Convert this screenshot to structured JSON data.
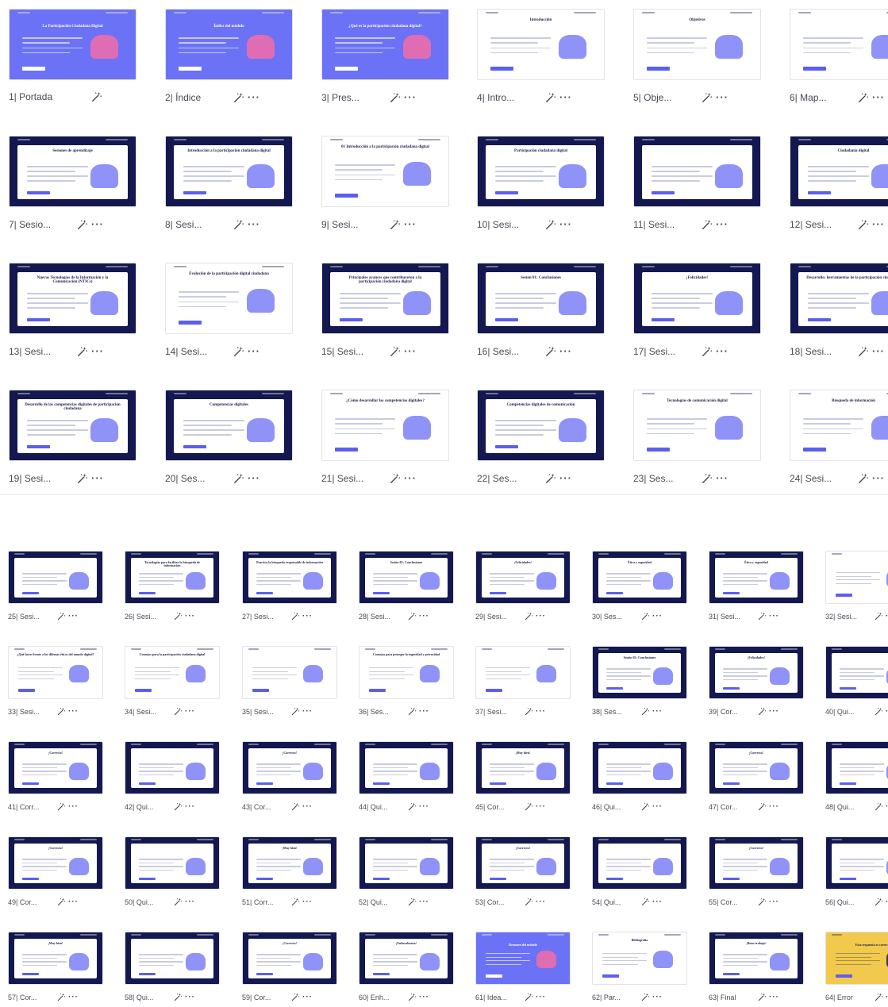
{
  "colors": {
    "purple": "#6c72f5",
    "navy": "#141850",
    "white": "#ffffff",
    "yellow": "#f1c94c",
    "text_dark": "#1d1d4a",
    "caption": "#4a4a55"
  },
  "icons": {
    "wand": "magic-wand-icon",
    "more": "more-options-icon"
  },
  "section1": {
    "slides": [
      {
        "label": "1| Portada",
        "bg": "purple",
        "title": "La Participación Ciudadana Digital",
        "more": false
      },
      {
        "label": "2| Índice",
        "bg": "purple",
        "title": "Índice del módulo",
        "more": true
      },
      {
        "label": "3| Pres...",
        "bg": "purple",
        "title": "¿Qué es la participación ciudadana digital?",
        "more": true
      },
      {
        "label": "4| Intro...",
        "bg": "white",
        "title": "Introducción",
        "more": true
      },
      {
        "label": "5| Obje...",
        "bg": "white",
        "title": "Objetivos",
        "more": true
      },
      {
        "label": "6| Map...",
        "bg": "white",
        "title": "",
        "more": true
      },
      {
        "label": "7| Sesio...",
        "bg": "navy",
        "title": "Sesiones de aprendizaje",
        "more": true
      },
      {
        "label": "8| Sesi...",
        "bg": "navy",
        "title": "Introducción a la participación ciudadana digital",
        "more": true
      },
      {
        "label": "9| Sesi...",
        "bg": "white",
        "title": "01 Introducción a la participación ciudadana digital",
        "more": true
      },
      {
        "label": "10| Sesi...",
        "bg": "navy",
        "title": "Participación ciudadana digital",
        "more": true
      },
      {
        "label": "11| Sesi...",
        "bg": "navy",
        "title": "",
        "more": true
      },
      {
        "label": "12| Sesi...",
        "bg": "navy",
        "title": "Ciudadanía digital",
        "more": true
      },
      {
        "label": "13| Sesi...",
        "bg": "navy",
        "title": "Nuevas Tecnologías de la Información y la Comunicación (NTICs)",
        "more": true
      },
      {
        "label": "14| Sesi...",
        "bg": "white",
        "title": "Evolución de la participación digital ciudadana",
        "more": true
      },
      {
        "label": "15| Sesi...",
        "bg": "navy",
        "title": "Principales avances que contribuyeron a la participación ciudadana digital",
        "more": true
      },
      {
        "label": "16| Sesi...",
        "bg": "navy",
        "title": "Sesión 01: Conclusiones",
        "more": true
      },
      {
        "label": "17| Sesi...",
        "bg": "navy",
        "title": "¡Felicidades!",
        "more": true
      },
      {
        "label": "18| Sesi...",
        "bg": "navy",
        "title": "Desarrollo: herramientas de la participación ciudadana",
        "more": true
      },
      {
        "label": "19| Sesi...",
        "bg": "navy",
        "title": "Desarrollo de las competencias digitales de participación ciudadana",
        "more": true
      },
      {
        "label": "20| Ses...",
        "bg": "navy",
        "title": "Competencias digitales",
        "more": true
      },
      {
        "label": "21| Sesi...",
        "bg": "white",
        "title": "¿Cómo desarrollar las competencias digitales?",
        "more": true
      },
      {
        "label": "22| Ses...",
        "bg": "navy",
        "title": "Competencias digitales de comunicación",
        "more": true
      },
      {
        "label": "23| Ses...",
        "bg": "white",
        "title": "Tecnologías de comunicación digital",
        "more": true
      },
      {
        "label": "24| Sesi...",
        "bg": "white",
        "title": "Búsqueda de información",
        "more": true
      }
    ]
  },
  "section2": {
    "slides": [
      {
        "label": "25| Sesi...",
        "bg": "navy",
        "title": ""
      },
      {
        "label": "26| Sesi...",
        "bg": "navy",
        "title": "Tecnologías para facilitar la búsqueda de información"
      },
      {
        "label": "27| Sesi...",
        "bg": "navy",
        "title": "Practica la búsqueda responsable de información"
      },
      {
        "label": "28| Sesi...",
        "bg": "navy",
        "title": "Sesión 02: Conclusiones"
      },
      {
        "label": "29| Sesi...",
        "bg": "navy",
        "title": "¡Felicidades!"
      },
      {
        "label": "30| Ses...",
        "bg": "navy",
        "title": "Ética y seguridad"
      },
      {
        "label": "31| Sesi...",
        "bg": "navy",
        "title": "Ética y seguridad"
      },
      {
        "label": "32| Sesi...",
        "bg": "white",
        "title": ""
      },
      {
        "label": "33| Sesi...",
        "bg": "white",
        "title": "¿Qué hacer frente a los dilemas éticos del mundo digital?"
      },
      {
        "label": "34| Sesi...",
        "bg": "white",
        "title": "Consejos para la participación ciudadana digital"
      },
      {
        "label": "35| Sesi...",
        "bg": "white",
        "title": ""
      },
      {
        "label": "36| Ses...",
        "bg": "white",
        "title": "Consejos para proteger la seguridad y privacidad"
      },
      {
        "label": "37| Sesi...",
        "bg": "white",
        "title": ""
      },
      {
        "label": "38| Ses...",
        "bg": "navy",
        "title": "Sesión 03: Conclusiones"
      },
      {
        "label": "39| Cor...",
        "bg": "navy",
        "title": "¡Felicidades!"
      },
      {
        "label": "40| Qui...",
        "bg": "navy",
        "title": ""
      },
      {
        "label": "41| Corr...",
        "bg": "navy",
        "title": "¡Correcto!"
      },
      {
        "label": "42| Qui...",
        "bg": "navy",
        "title": ""
      },
      {
        "label": "43| Cor...",
        "bg": "navy",
        "title": "¡Correcto!"
      },
      {
        "label": "44| Qui...",
        "bg": "navy",
        "title": ""
      },
      {
        "label": "45| Cor...",
        "bg": "navy",
        "title": "¡Muy bien!"
      },
      {
        "label": "46| Qui...",
        "bg": "navy",
        "title": ""
      },
      {
        "label": "47| Cor...",
        "bg": "navy",
        "title": "¡Correcto!"
      },
      {
        "label": "48| Qui...",
        "bg": "navy",
        "title": ""
      },
      {
        "label": "49| Cor...",
        "bg": "navy",
        "title": "¡Correcto!"
      },
      {
        "label": "50| Qui...",
        "bg": "navy",
        "title": ""
      },
      {
        "label": "51| Corr...",
        "bg": "navy",
        "title": "¡Muy bien!"
      },
      {
        "label": "52| Qui...",
        "bg": "navy",
        "title": ""
      },
      {
        "label": "53| Cor...",
        "bg": "navy",
        "title": "¡Correcto!"
      },
      {
        "label": "54| Qui...",
        "bg": "navy",
        "title": ""
      },
      {
        "label": "55| Cor...",
        "bg": "navy",
        "title": "¡Correcto!"
      },
      {
        "label": "56| Qui...",
        "bg": "navy",
        "title": ""
      },
      {
        "label": "57| Cor...",
        "bg": "navy",
        "title": "¡Muy bien!"
      },
      {
        "label": "58| Qui...",
        "bg": "navy",
        "title": ""
      },
      {
        "label": "59| Cor...",
        "bg": "navy",
        "title": "¡Correcto!"
      },
      {
        "label": "60| Enh...",
        "bg": "navy",
        "title": "¡Enhorabuena!"
      },
      {
        "label": "61| Idea...",
        "bg": "purple",
        "title": "Resumen del módulo"
      },
      {
        "label": "62| Par...",
        "bg": "white",
        "title": "Bibliografía"
      },
      {
        "label": "63| Final",
        "bg": "navy",
        "title": "¡Buen trabajo!"
      },
      {
        "label": "64| Error",
        "bg": "yellow",
        "title": "Esta respuesta es correcta"
      }
    ]
  }
}
